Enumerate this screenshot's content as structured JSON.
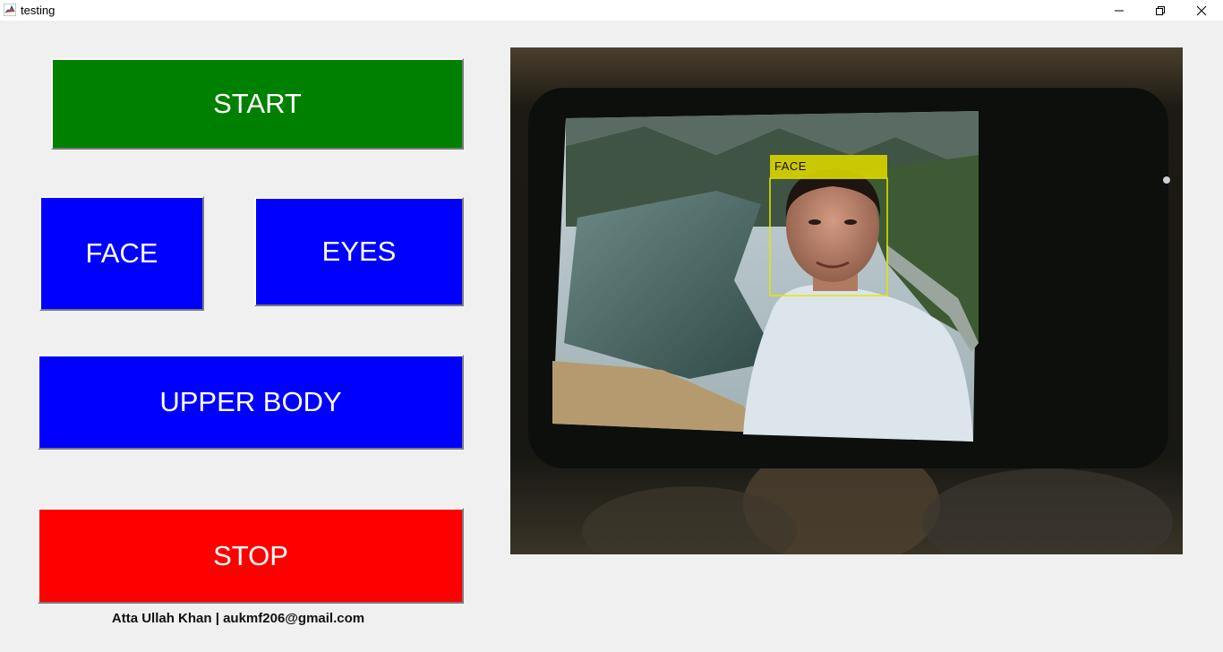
{
  "window": {
    "title": "testing"
  },
  "buttons": {
    "start": "START",
    "face": "FACE",
    "eyes": "EYES",
    "upper_body": "UPPER BODY",
    "stop": "STOP"
  },
  "detection": {
    "label": "FACE"
  },
  "footer": {
    "credit": "Atta Ullah Khan | aukmf206@gmail.com"
  },
  "colors": {
    "start": "#008000",
    "feature": "#0000ff",
    "stop": "#ff0000",
    "detection_box": "#e6e600"
  },
  "icons": {
    "app": "matlab-icon",
    "minimize": "minimize-icon",
    "restore": "restore-icon",
    "close": "close-icon"
  }
}
